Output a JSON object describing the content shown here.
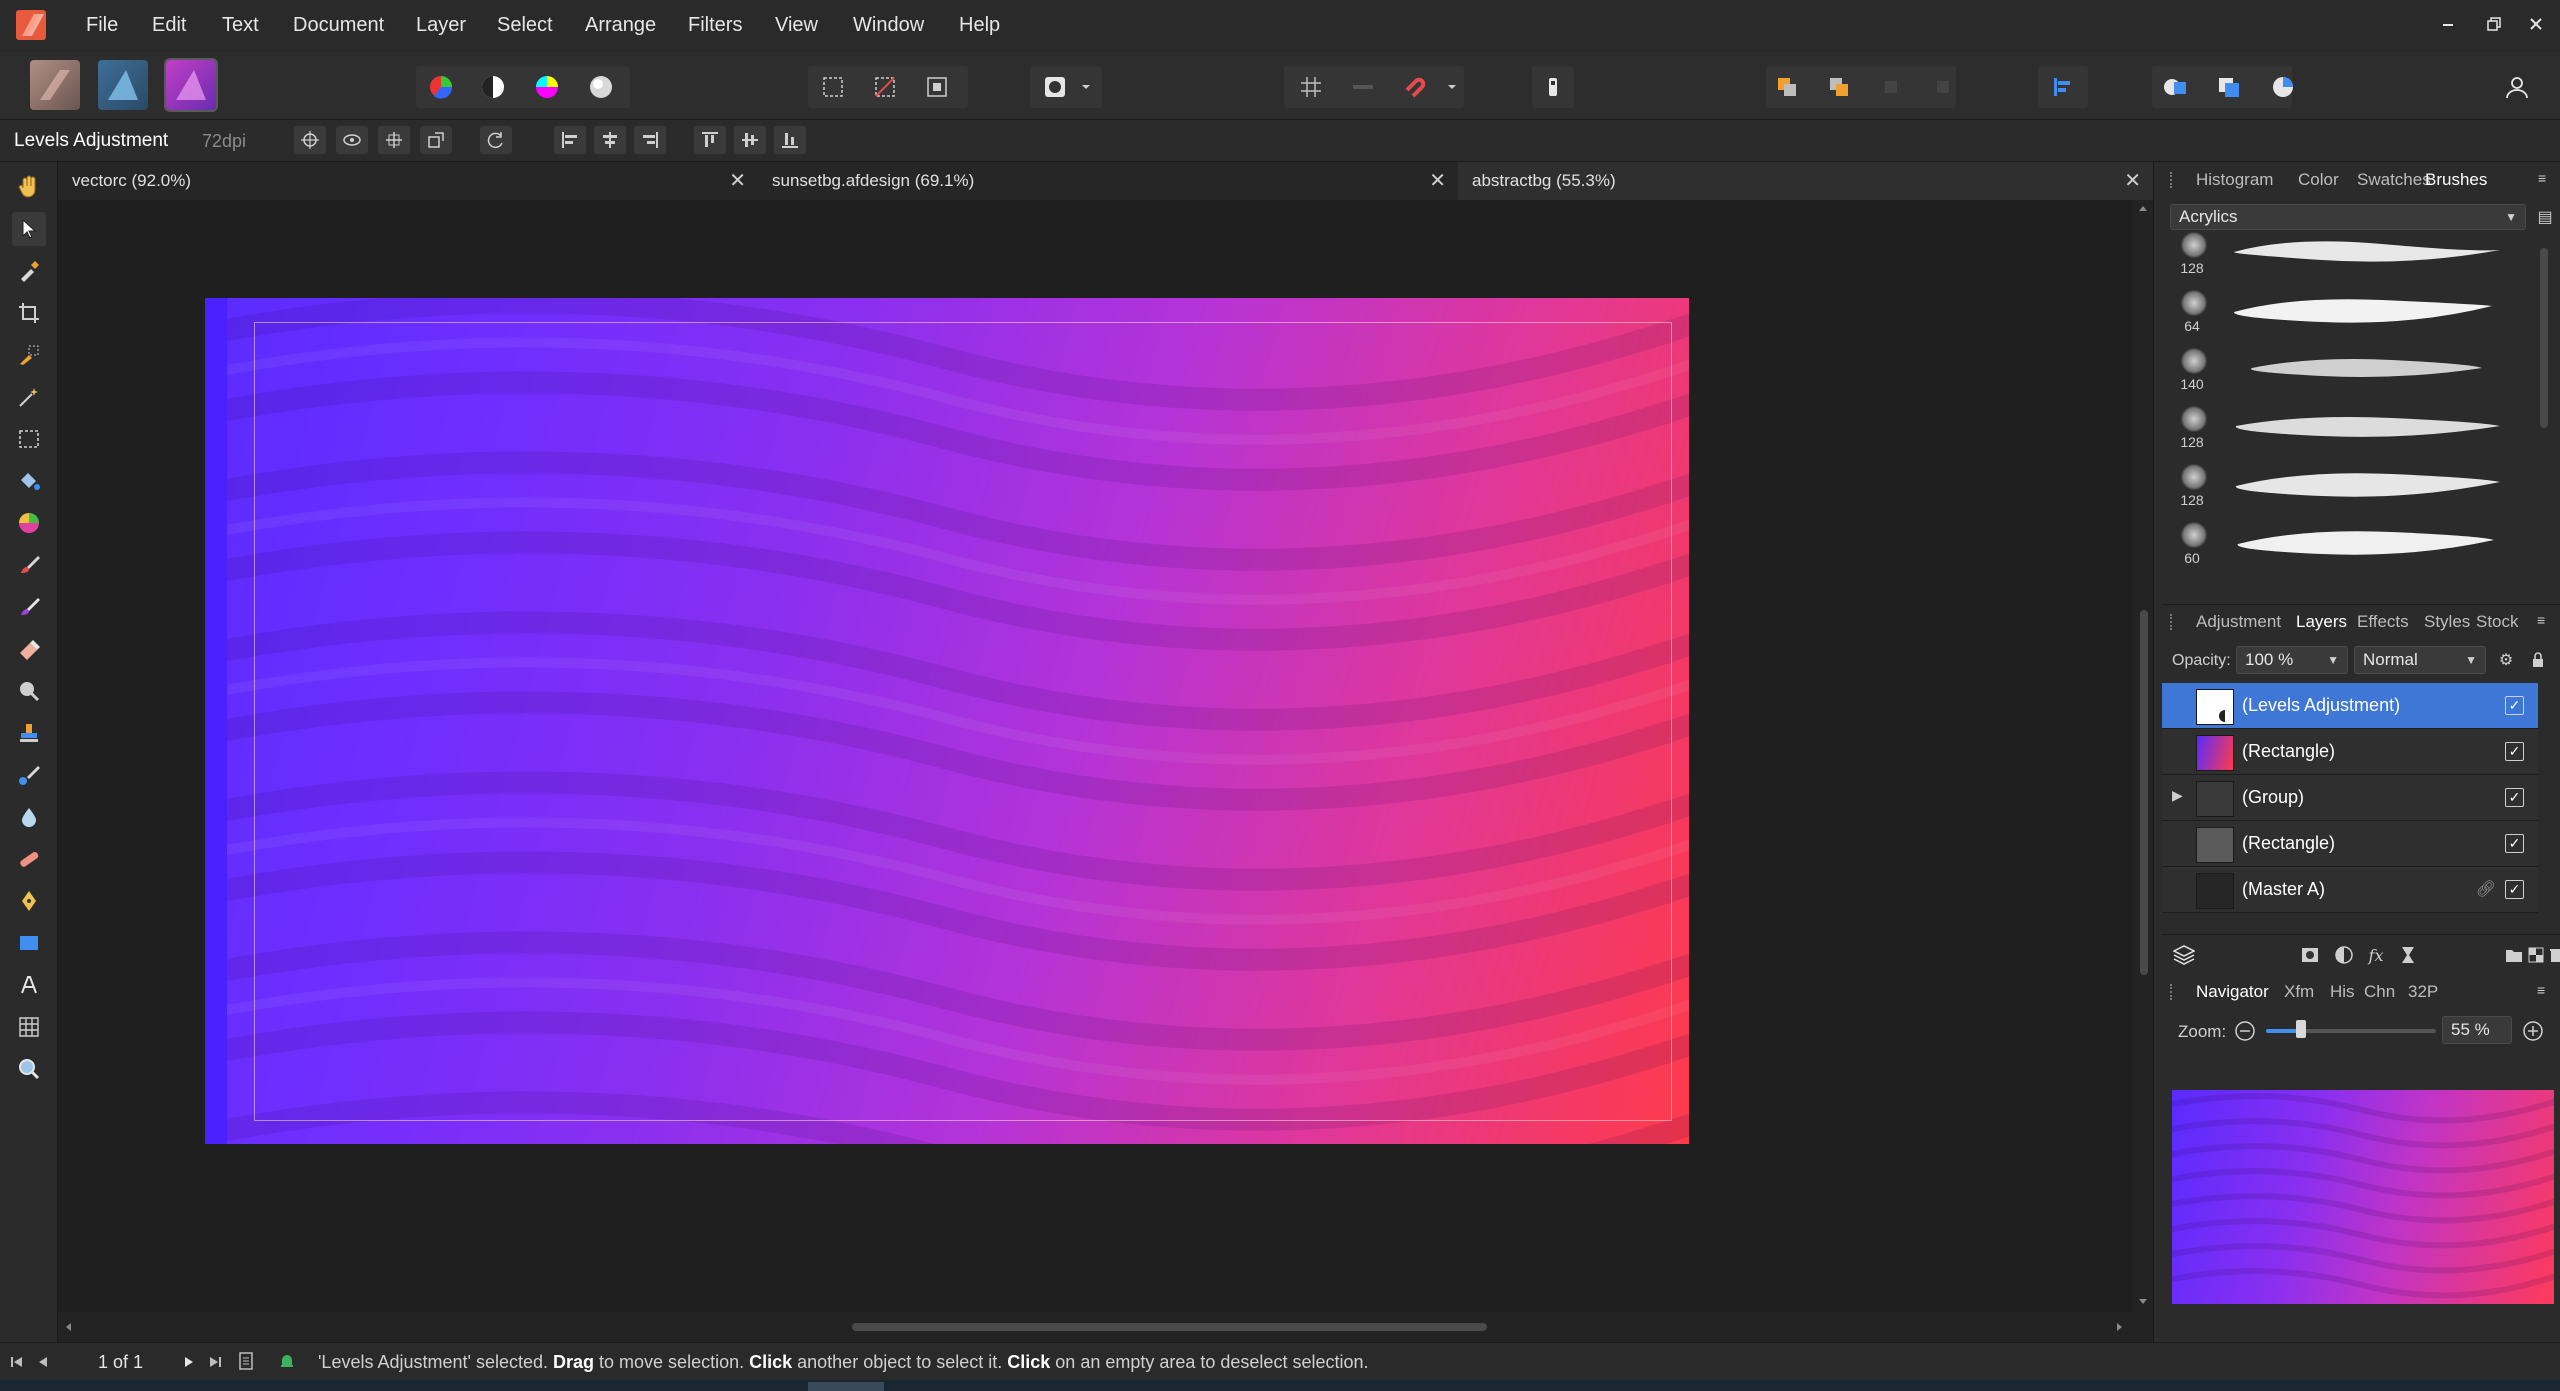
{
  "menu": [
    "File",
    "Edit",
    "Text",
    "Document",
    "Layer",
    "Select",
    "Arrange",
    "Filters",
    "View",
    "Window",
    "Help"
  ],
  "context": {
    "tool_label": "Levels Adjustment",
    "dpi": "72dpi"
  },
  "tabs": [
    {
      "label": "vectorc (92.0%)"
    },
    {
      "label": "sunsetbg.afdesign (69.1%)"
    },
    {
      "label": "abstractbg (55.3%)"
    }
  ],
  "brush_panel": {
    "tabs": [
      "Histogram",
      "Color",
      "Swatches",
      "Brushes"
    ],
    "active_tab": "Brushes",
    "category": "Acrylics",
    "brushes": [
      {
        "size": "128"
      },
      {
        "size": "64"
      },
      {
        "size": "140"
      },
      {
        "size": "128"
      },
      {
        "size": "128"
      },
      {
        "size": "60"
      }
    ]
  },
  "layers_panel": {
    "tabs": [
      "Adjustment",
      "Layers",
      "Effects",
      "Styles",
      "Stock"
    ],
    "active_tab": "Layers",
    "opacity_label": "Opacity:",
    "opacity_value": "100 %",
    "blend_mode": "Normal",
    "layers": [
      {
        "name": "(Levels Adjustment)",
        "selected": true
      },
      {
        "name": "(Rectangle)"
      },
      {
        "name": "(Group)"
      },
      {
        "name": "(Rectangle)"
      },
      {
        "name": "(Master A)"
      }
    ]
  },
  "navigator_panel": {
    "tabs": [
      "Navigator",
      "Xfm",
      "His",
      "Chn",
      "32P"
    ],
    "active_tab": "Navigator",
    "zoom_label": "Zoom:",
    "zoom_value": "55 %"
  },
  "status": {
    "page": "1 of 1",
    "msg_1": "'Levels Adjustment' selected. ",
    "msg_drag": "Drag",
    "msg_2": " to move selection. ",
    "msg_click": "Click",
    "msg_3": " another object to select it. ",
    "msg_click2": "Click",
    "msg_4": " on an empty area to deselect selection."
  },
  "colors": {
    "accent": "#3f77d6",
    "panel_bg": "#2b2b2b",
    "canvas_bg": "#1f1f1f",
    "gradient_start": "#5a2bff",
    "gradient_end": "#ff3a4a"
  }
}
